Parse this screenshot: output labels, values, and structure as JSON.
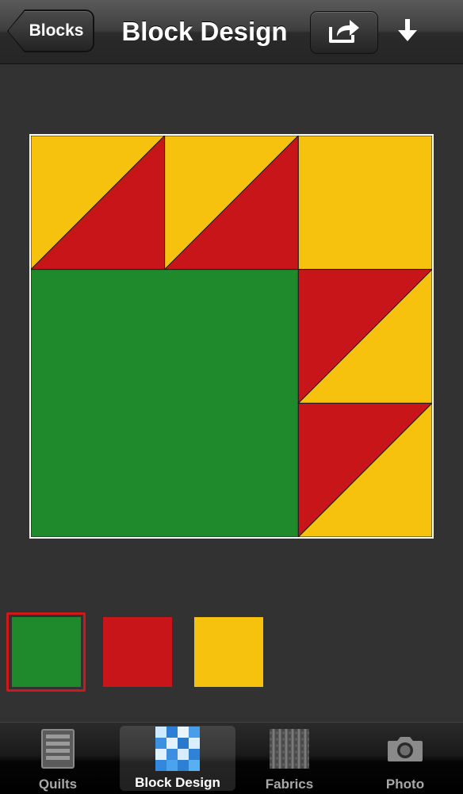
{
  "navbar": {
    "back_label": "Blocks",
    "title": "Block Design",
    "share_icon": "share-icon",
    "download_icon": "download-arrow-icon"
  },
  "block": {
    "grid_units": 3,
    "colors": {
      "green": "#1f8a2c",
      "red": "#c8151a",
      "yellow": "#f7c20e"
    },
    "patches": [
      {
        "kind": "hst",
        "col": 0,
        "row": 0,
        "upper": "yellow",
        "lower": "red",
        "diagonal": "bl-tr"
      },
      {
        "kind": "hst",
        "col": 1,
        "row": 0,
        "upper": "yellow",
        "lower": "red",
        "diagonal": "bl-tr"
      },
      {
        "kind": "square",
        "col": 2,
        "row": 0,
        "fill": "yellow"
      },
      {
        "kind": "square_2x2",
        "col": 0,
        "row": 1,
        "fill": "green"
      },
      {
        "kind": "hst",
        "col": 2,
        "row": 1,
        "upper": "red",
        "lower": "yellow",
        "diagonal": "bl-tr"
      },
      {
        "kind": "hst",
        "col": 2,
        "row": 2,
        "upper": "red",
        "lower": "yellow",
        "diagonal": "bl-tr"
      }
    ]
  },
  "palette": {
    "selected_index": 0,
    "swatches": [
      {
        "name": "green",
        "color": "#1f8a2c"
      },
      {
        "name": "red",
        "color": "#c8151a"
      },
      {
        "name": "yellow",
        "color": "#f7c20e"
      }
    ]
  },
  "tabbar": {
    "active": "Block Design",
    "tabs": [
      {
        "label": "Quilts",
        "icon": "quilt-stack-icon"
      },
      {
        "label": "Block Design",
        "icon": "block-grid-icon"
      },
      {
        "label": "Fabrics",
        "icon": "fabric-weave-icon"
      },
      {
        "label": "Photo",
        "icon": "camera-icon"
      }
    ]
  }
}
